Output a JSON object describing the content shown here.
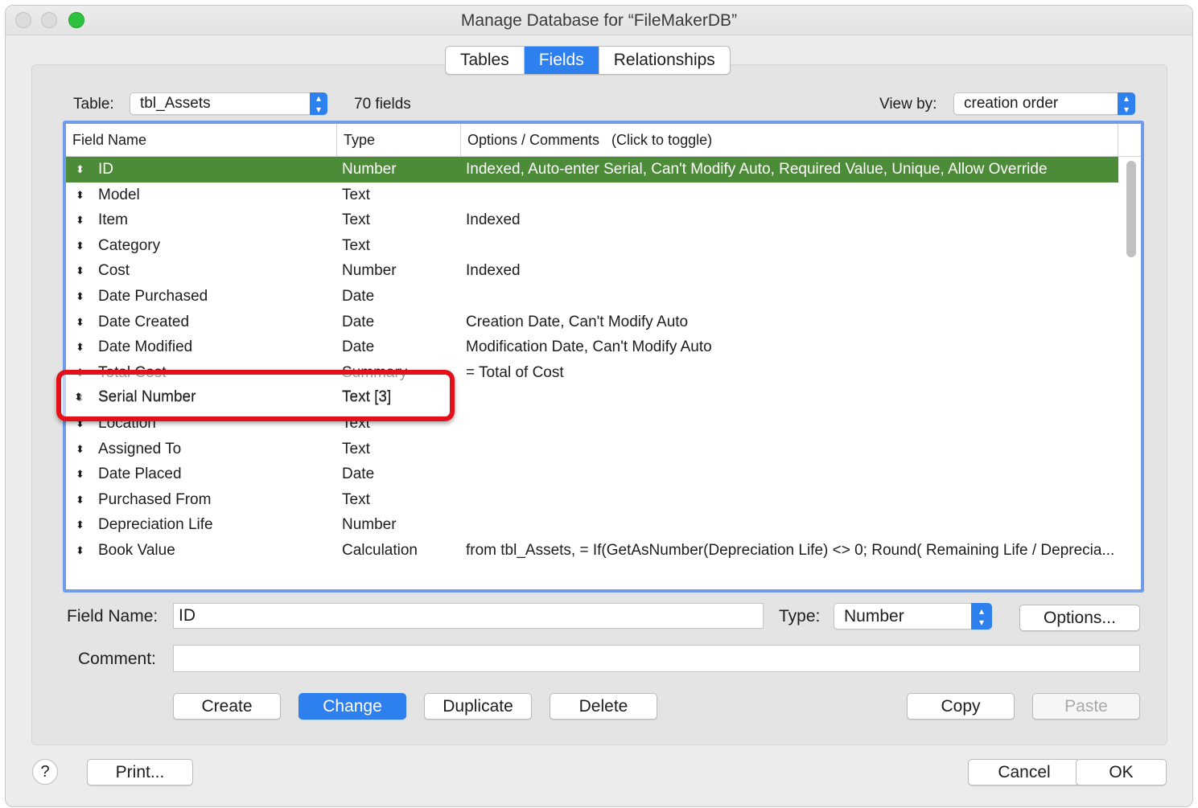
{
  "window": {
    "title": "Manage Database for “FileMakerDB”"
  },
  "tabs": [
    {
      "label": "Tables",
      "active": false
    },
    {
      "label": "Fields",
      "active": true
    },
    {
      "label": "Relationships",
      "active": false
    }
  ],
  "table_selector": {
    "label": "Table:",
    "value": "tbl_Assets",
    "field_count": "70 fields"
  },
  "view_by": {
    "label": "View by:",
    "value": "creation order"
  },
  "columns": {
    "name": "Field Name",
    "type": "Type",
    "options": "Options / Comments   (Click to toggle)"
  },
  "rows": [
    {
      "name": "ID",
      "type": "Number",
      "options": "Indexed, Auto-enter Serial, Can't Modify Auto, Required Value, Unique, Allow Override",
      "selected": true
    },
    {
      "name": "Model",
      "type": "Text",
      "options": ""
    },
    {
      "name": "Item",
      "type": "Text",
      "options": "Indexed"
    },
    {
      "name": "Category",
      "type": "Text",
      "options": ""
    },
    {
      "name": "Cost",
      "type": "Number",
      "options": "Indexed"
    },
    {
      "name": "Date Purchased",
      "type": "Date",
      "options": ""
    },
    {
      "name": "Date Created",
      "type": "Date",
      "options": "Creation Date, Can't Modify Auto"
    },
    {
      "name": "Date Modified",
      "type": "Date",
      "options": "Modification Date, Can't Modify Auto"
    },
    {
      "name": "Total Cost",
      "type": "Summary",
      "options": "= Total of Cost"
    },
    {
      "name": "Serial Number",
      "type": "Text [3]",
      "options": ""
    },
    {
      "name": "Location",
      "type": "Text",
      "options": ""
    },
    {
      "name": "Assigned To",
      "type": "Text",
      "options": ""
    },
    {
      "name": "Date Placed",
      "type": "Date",
      "options": ""
    },
    {
      "name": "Purchased From",
      "type": "Text",
      "options": ""
    },
    {
      "name": "Depreciation Life",
      "type": "Number",
      "options": ""
    },
    {
      "name": "Book Value",
      "type": "Calculation",
      "options": "from tbl_Assets, = If(GetAsNumber(Depreciation Life) <> 0; Round( Remaining Life / Deprecia..."
    }
  ],
  "highlighted_row": {
    "name": "Serial Number",
    "type": "Text [3]"
  },
  "editor": {
    "field_name_label": "Field Name:",
    "field_name_value": "ID",
    "type_label": "Type:",
    "type_value": "Number",
    "options_button": "Options...",
    "comment_label": "Comment:",
    "comment_value": ""
  },
  "actions": {
    "create": "Create",
    "change": "Change",
    "duplicate": "Duplicate",
    "delete": "Delete",
    "copy": "Copy",
    "paste": "Paste"
  },
  "footer": {
    "help": "?",
    "print": "Print...",
    "cancel": "Cancel",
    "ok": "OK"
  },
  "colors": {
    "accent": "#2f80ef",
    "selected_row": "#4c8b37",
    "highlight": "#e3101a"
  }
}
